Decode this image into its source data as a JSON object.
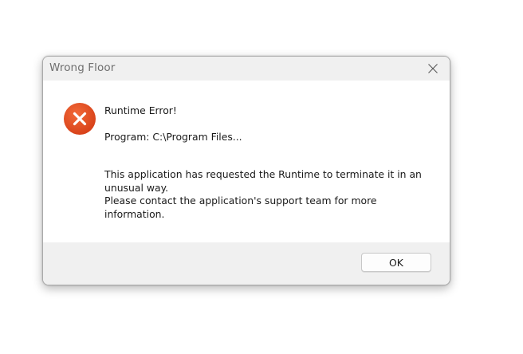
{
  "window": {
    "title": "Wrong Floor"
  },
  "message": {
    "heading": "Runtime Error!",
    "program": "Program: C:\\Program Files...",
    "body_line1": "This application has requested the Runtime to terminate it in an unusual way.",
    "body_line2": "Please contact the application's support team for more information."
  },
  "buttons": {
    "ok_label": "OK"
  },
  "icons": {
    "error": "error-x-icon",
    "close": "close-icon"
  },
  "colors": {
    "error_icon": "#e04a1a",
    "dialog_bg": "#f0f0f0",
    "content_bg": "#ffffff"
  }
}
